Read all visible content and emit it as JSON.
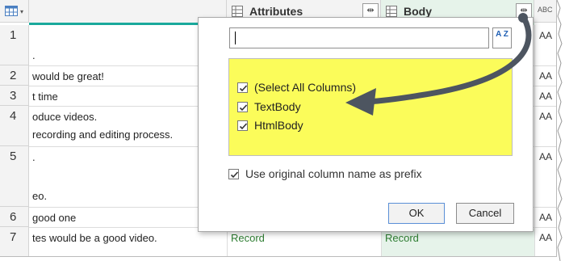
{
  "header": {
    "attributes_title": "Attributes",
    "body_title": "Body",
    "abc_label": "ABC"
  },
  "rows": [
    {
      "num": "1",
      "lines": [
        "",
        "."
      ]
    },
    {
      "num": "2",
      "lines": [
        "would be great!"
      ]
    },
    {
      "num": "3",
      "lines": [
        "t time"
      ]
    },
    {
      "num": "4",
      "lines": [
        "oduce videos.",
        " recording and editing process."
      ]
    },
    {
      "num": "5",
      "lines": [
        ".",
        "",
        "eo."
      ]
    },
    {
      "num": "6",
      "lines": [
        " good one"
      ]
    },
    {
      "num": "7",
      "lines": [
        "tes would be a good video."
      ]
    }
  ],
  "right_col_values": [
    "AA",
    "AA",
    "AA",
    "AA",
    "AA",
    "AA",
    "AA"
  ],
  "record_values": {
    "attributes": "Record",
    "body": "Record"
  },
  "popup": {
    "search_value": "",
    "sort_icon_label": "A Z",
    "items": [
      {
        "label": "(Select All Columns)",
        "checked": true
      },
      {
        "label": "TextBody",
        "checked": true
      },
      {
        "label": "HtmlBody",
        "checked": true
      }
    ],
    "prefix_label": "Use original column name as prefix",
    "prefix_checked": true,
    "ok_label": "OK",
    "cancel_label": "Cancel"
  },
  "colors": {
    "list_highlight": "#fbfc5a",
    "accent_teal": "#1aa99c",
    "record_green": "#2e7d32",
    "arrow": "#4d5560"
  }
}
